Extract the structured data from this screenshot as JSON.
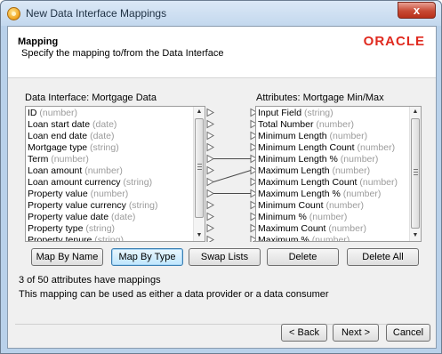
{
  "window": {
    "title": "New Data Interface Mappings",
    "close_glyph": "x"
  },
  "header": {
    "title": "Mapping",
    "subtitle": "Specify the mapping to/from the Data Interface",
    "logo": "ORACLE"
  },
  "left_list": {
    "title": "Data Interface: Mortgage Data",
    "items": [
      {
        "name": "ID",
        "type": "(number)"
      },
      {
        "name": "Loan start date",
        "type": "(date)"
      },
      {
        "name": "Loan end date",
        "type": "(date)"
      },
      {
        "name": "Mortgage type",
        "type": "(string)"
      },
      {
        "name": "Term",
        "type": "(number)"
      },
      {
        "name": "Loan amount",
        "type": "(number)"
      },
      {
        "name": "Loan amount currency",
        "type": "(string)"
      },
      {
        "name": "Property value",
        "type": "(number)"
      },
      {
        "name": "Property value currency",
        "type": "(string)"
      },
      {
        "name": "Property value date",
        "type": "(date)"
      },
      {
        "name": "Property type",
        "type": "(string)"
      },
      {
        "name": "Property tenure",
        "type": "(string)"
      }
    ]
  },
  "right_list": {
    "title": "Attributes: Mortgage Min/Max",
    "items": [
      {
        "name": "Input Field",
        "type": "(string)"
      },
      {
        "name": "Total Number",
        "type": "(number)"
      },
      {
        "name": "Minimum Length",
        "type": "(number)"
      },
      {
        "name": "Minimum Length Count",
        "type": "(number)"
      },
      {
        "name": "Minimum Length %",
        "type": "(number)"
      },
      {
        "name": "Maximum Length",
        "type": "(number)"
      },
      {
        "name": "Maximum Length Count",
        "type": "(number)"
      },
      {
        "name": "Maximum Length %",
        "type": "(number)"
      },
      {
        "name": "Minimum Count",
        "type": "(number)"
      },
      {
        "name": "Minimum %",
        "type": "(number)"
      },
      {
        "name": "Maximum Count",
        "type": "(number)"
      },
      {
        "name": "Maximum %",
        "type": "(number)"
      }
    ]
  },
  "buttons": {
    "map_by_name": "Map By Name",
    "map_by_type": "Map By Type",
    "swap_lists": "Swap Lists",
    "delete": "Delete",
    "delete_all": "Delete All"
  },
  "status": {
    "mapping_count": "3 of 50 attributes have mappings",
    "usage_note": "This mapping can be used as either a data provider or a data consumer"
  },
  "footer": {
    "back": "< Back",
    "next": "Next >",
    "cancel": "Cancel"
  },
  "colors": {
    "logo": "#e02a1f",
    "type_text": "#9b9b9b",
    "title_bar": "#c3d8ee"
  }
}
